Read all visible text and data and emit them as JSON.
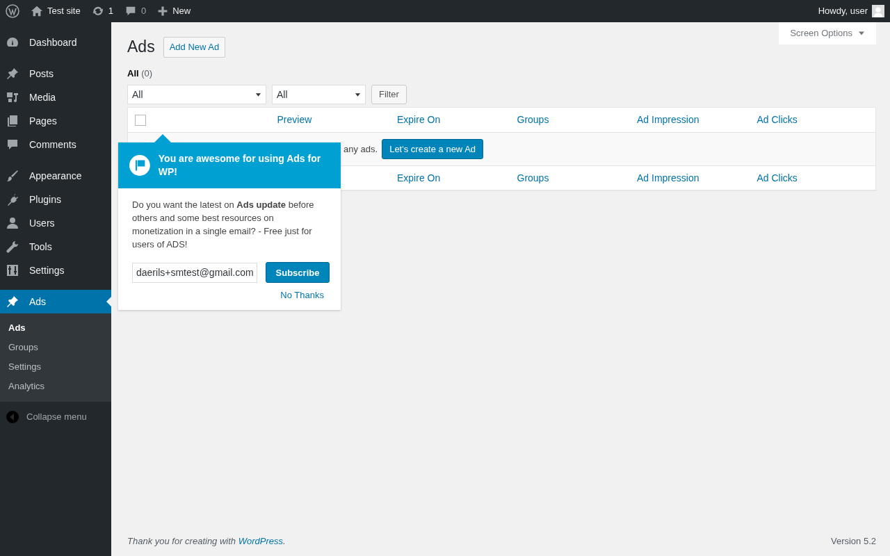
{
  "admin_bar": {
    "site": "Test site",
    "updates": "1",
    "comments": "0",
    "new": "New",
    "greeting": "Howdy, user"
  },
  "sidebar": {
    "groups": [
      {
        "items": [
          {
            "label": "Dashboard",
            "selected": false
          }
        ]
      },
      {
        "items": [
          {
            "label": "Posts",
            "selected": false
          },
          {
            "label": "Media",
            "selected": false
          },
          {
            "label": "Pages",
            "selected": false
          },
          {
            "label": "Comments",
            "selected": false
          }
        ]
      },
      {
        "items": [
          {
            "label": "Appearance",
            "selected": false
          },
          {
            "label": "Plugins",
            "selected": false
          },
          {
            "label": "Users",
            "selected": false
          },
          {
            "label": "Tools",
            "selected": false
          },
          {
            "label": "Settings",
            "selected": false
          }
        ]
      },
      {
        "items": [
          {
            "label": "Ads",
            "selected": true,
            "submenu": [
              {
                "label": "Ads",
                "selected": true
              },
              {
                "label": "Groups",
                "selected": false
              },
              {
                "label": "Settings",
                "selected": false
              },
              {
                "label": "Analytics",
                "selected": false
              }
            ]
          }
        ]
      }
    ],
    "collapse": "Collapse menu"
  },
  "screen_options": "Screen Options",
  "page": {
    "title": "Ads",
    "add_button": "Add New Ad"
  },
  "views": [
    {
      "label": "All",
      "count": "(0)",
      "selected": true
    }
  ],
  "filters": [
    {
      "value": "All"
    },
    {
      "value": "All"
    }
  ],
  "filter_button": "Filter",
  "table": {
    "select_all_checked": false,
    "header": [
      {
        "label": "Preview"
      },
      {
        "label": "Expire On"
      },
      {
        "label": "Groups"
      },
      {
        "label": "Ad Impression"
      },
      {
        "label": "Ad Clicks"
      }
    ],
    "empty_text": "any ads.",
    "empty_button": "Let's create a new Ad",
    "footer": [
      {
        "label": "Expire On"
      },
      {
        "label": "Groups"
      },
      {
        "label": "Ad Impression"
      },
      {
        "label": "Ad Clicks"
      }
    ]
  },
  "popup": {
    "title": "You are awesome for using Ads for WP!",
    "body": "Do you want the latest on **Ads update** before others and some best resources on monetization in a single email? - Free just for users of ADS!",
    "email": "daerils+smtest@gmail.com",
    "subscribe": "Subscribe",
    "dismiss": "No Thanks"
  },
  "footer": {
    "thanks": "Thank you for creating with",
    "link": "WordPress",
    "end": ".",
    "version": "Version 5.2"
  }
}
